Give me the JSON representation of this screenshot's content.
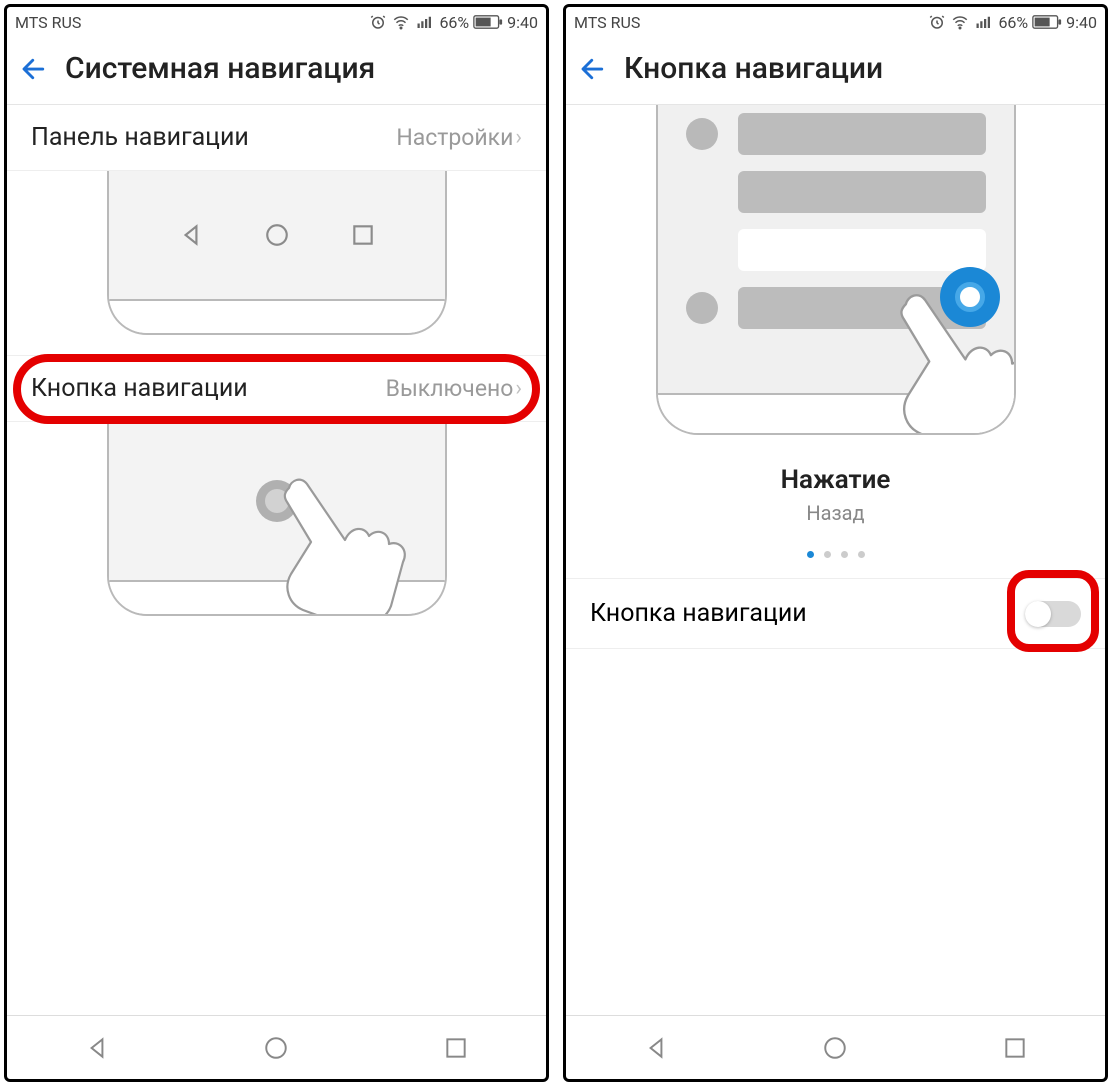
{
  "statusbar": {
    "carrier": "MTS RUS",
    "battery": "66%",
    "time": "9:40"
  },
  "screen1": {
    "title": "Системная навигация",
    "row1": {
      "label": "Панель навигации",
      "value": "Настройки"
    },
    "row2": {
      "label": "Кнопка навигации",
      "value": "Выключено"
    }
  },
  "screen2": {
    "title": "Кнопка навигации",
    "caption_title": "Нажатие",
    "caption_sub": "Назад",
    "toggle_label": "Кнопка навигации",
    "toggle_on": false,
    "dots_total": 4,
    "dots_active": 0
  }
}
